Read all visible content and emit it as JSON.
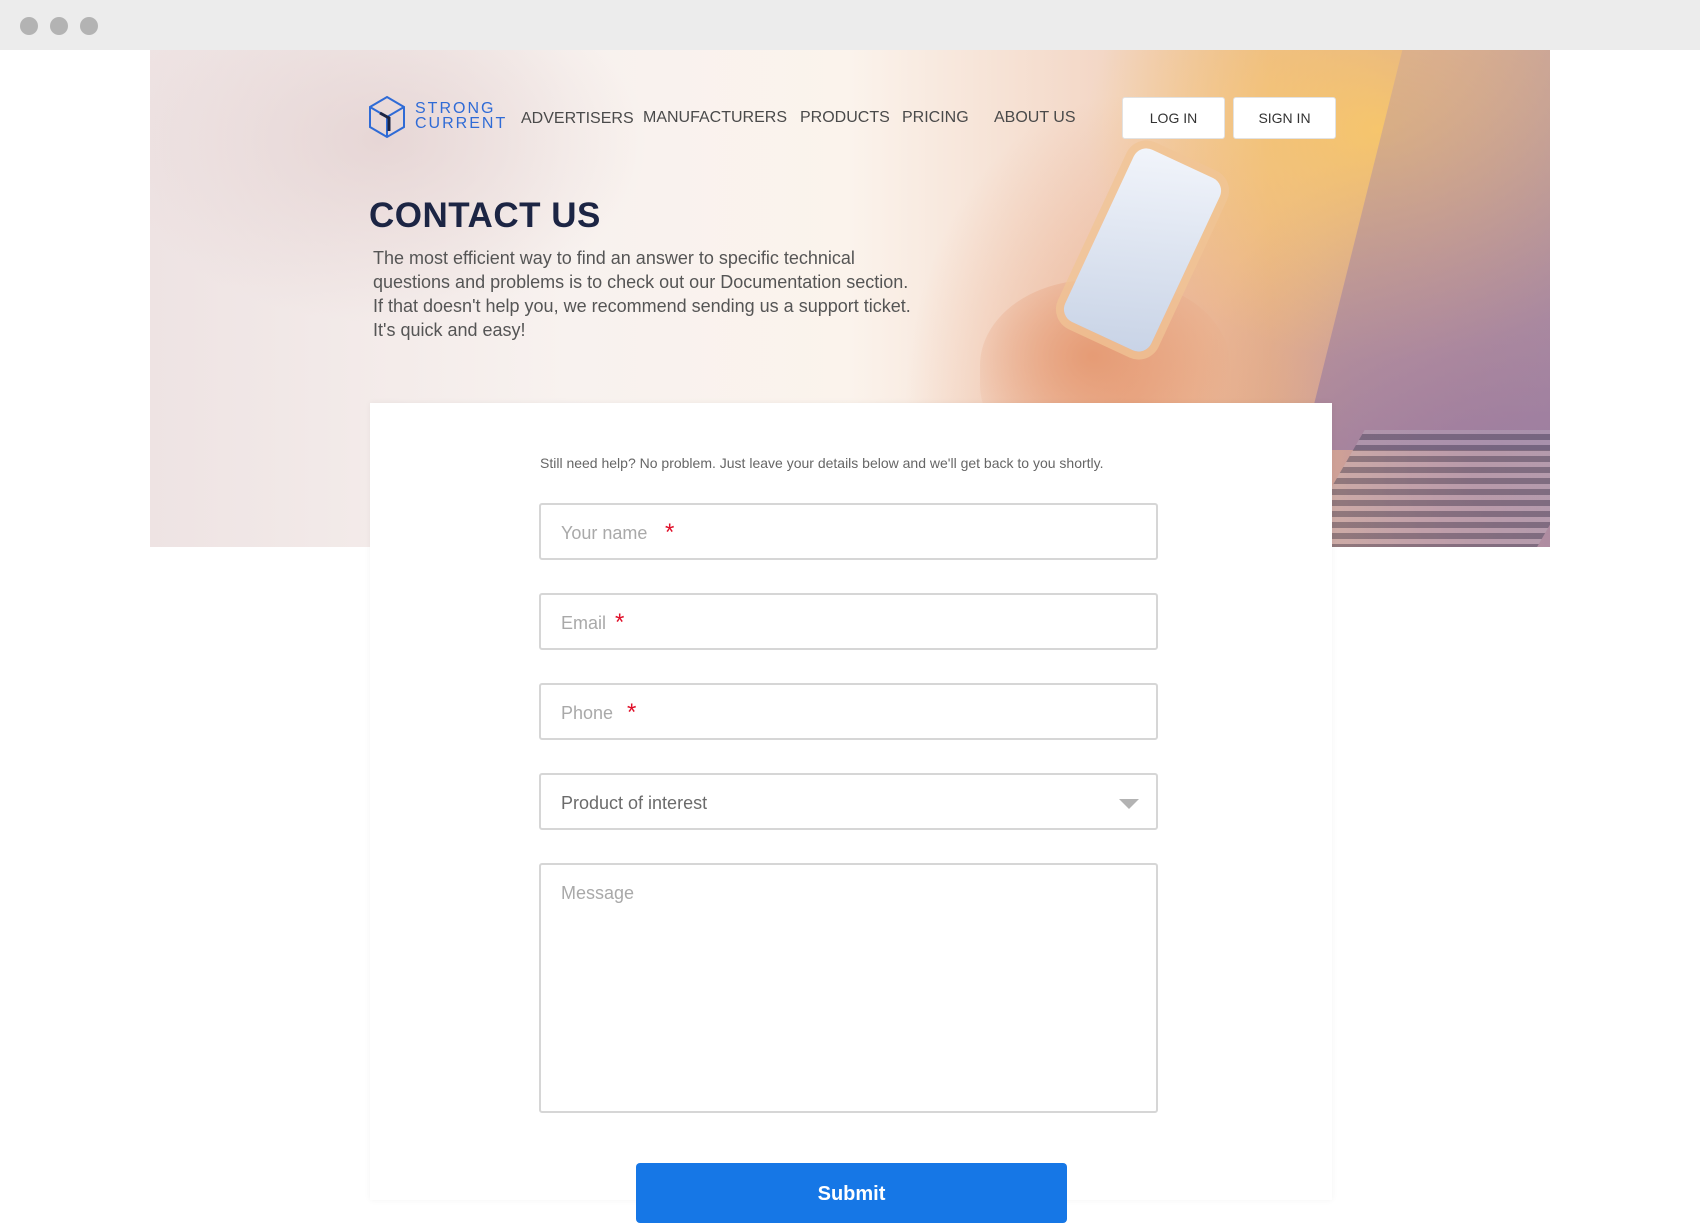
{
  "brand": {
    "line1": "STRONG",
    "line2": "CURRENT"
  },
  "nav": {
    "items": [
      "ADVERTISERS",
      "MANUFACTURERS",
      "PRODUCTS",
      "PRICING",
      "ABOUT US"
    ],
    "login": "LOG IN",
    "signin": "SIGN IN"
  },
  "hero": {
    "title": "CONTACT US",
    "intro_lines": [
      "The most efficient way to find an answer to specific technical",
      "questions and problems is to check out our Documentation section.",
      "If that doesn't help you, we recommend sending us a support ticket.",
      "It's quick and easy!"
    ]
  },
  "form": {
    "help": "Still need help? No problem. Just leave your details below and we'll get back to you shortly.",
    "name_placeholder": "Your name",
    "email_placeholder": "Email",
    "phone_placeholder": "Phone",
    "product_placeholder": "Product of interest",
    "message_placeholder": "Message",
    "required_mark": "*",
    "submit": "Submit"
  },
  "colors": {
    "brand_blue": "#2f6bd6",
    "primary_button": "#1677e6",
    "required": "#e0102a",
    "title": "#1c2544"
  },
  "icons": [
    "window-dot-icon",
    "logo-cube-icon",
    "chevron-down-icon"
  ]
}
